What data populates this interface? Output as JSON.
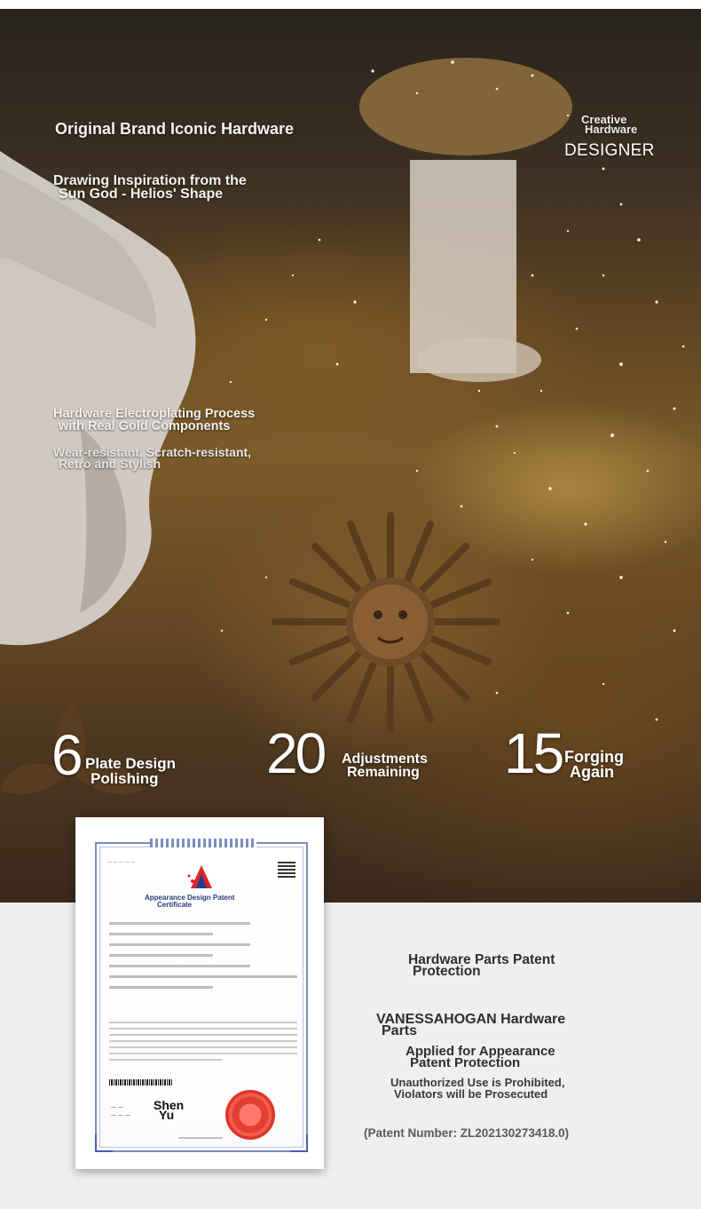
{
  "hero": {
    "headline": "Original Brand Iconic Hardware",
    "inspiration": [
      "Drawing Inspiration from the",
      "Sun God - Helios' Shape"
    ],
    "process": [
      "Hardware Electroplating Process",
      "with Real Gold Components"
    ],
    "features": [
      "Wear-resistant, Scratch-resistant,",
      "Retro and Stylish"
    ],
    "creative": [
      "Creative",
      "Hardware"
    ],
    "designer": "DESIGNER"
  },
  "stats": [
    {
      "number": "6",
      "label": [
        "Plate Design",
        "Polishing"
      ]
    },
    {
      "number": "20",
      "label": [
        "Adjustments",
        "Remaining"
      ]
    },
    {
      "number": "15",
      "label": [
        "Forging",
        "Again"
      ]
    }
  ],
  "certificate": {
    "title": [
      "Appearance Design Patent",
      "Certificate"
    ],
    "signature": [
      "Shen",
      "Yu"
    ]
  },
  "patent": {
    "title": [
      "Hardware Parts Patent",
      "Protection"
    ],
    "brand": [
      "VANESSAHOGAN Hardware",
      "Parts"
    ],
    "applied": [
      "Applied for Appearance",
      "Patent Protection"
    ],
    "warning": [
      "Unauthorized Use is Prohibited,",
      "Violators will be Prosecuted"
    ],
    "number": "(Patent Number: ZL202130273418.0)"
  },
  "colors": {
    "hero_gold": "#7a5a2a",
    "lower_bg": "#efefef",
    "cert_border": "#7b8cbf",
    "seal_red": "#e02a1c"
  }
}
